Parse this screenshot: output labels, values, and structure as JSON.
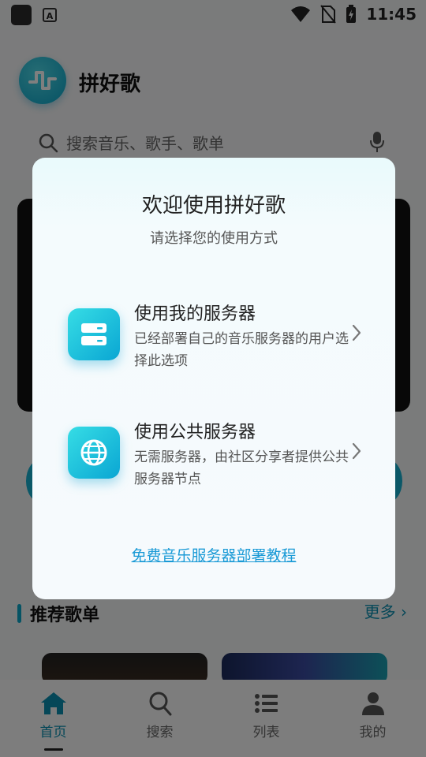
{
  "status_bar": {
    "time": "11:45",
    "icons": [
      "app-icon",
      "text-icon",
      "wifi-icon",
      "no-sim-icon",
      "battery-icon"
    ]
  },
  "header": {
    "app_title": "拼好歌",
    "search_placeholder": "搜索音乐、歌手、歌单"
  },
  "section": {
    "title": "推荐歌单",
    "more_label": "更多"
  },
  "tab_bar": {
    "tabs": [
      {
        "label": "首页",
        "icon": "home-icon",
        "active": true
      },
      {
        "label": "搜索",
        "icon": "search-icon",
        "active": false
      },
      {
        "label": "列表",
        "icon": "list-icon",
        "active": false
      },
      {
        "label": "我的",
        "icon": "user-icon",
        "active": false
      }
    ]
  },
  "dialog": {
    "title": "欢迎使用拼好歌",
    "subtitle": "请选择您的使用方式",
    "options": [
      {
        "title": "使用我的服务器",
        "desc": "已经部署自己的音乐服务器的用户选择此选项",
        "icon": "server-icon"
      },
      {
        "title": "使用公共服务器",
        "desc": "无需服务器，由社区分享者提供公共服务器节点",
        "icon": "globe-icon"
      }
    ],
    "link_text": "免费音乐服务器部署教程"
  },
  "colors": {
    "accent": "#0aa6c8",
    "link": "#1a9ad6",
    "overlay": "rgba(0,0,0,0.5)"
  }
}
